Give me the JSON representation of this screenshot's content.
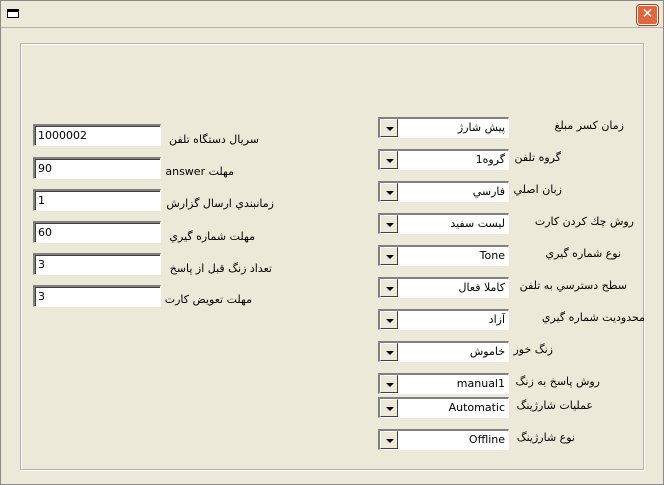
{
  "window": {
    "title": "",
    "close_glyph": "✕"
  },
  "left_fields": [
    {
      "label": "سريال دستگاه تلفن",
      "value": "1000002"
    },
    {
      "label": "مهلت answer",
      "value": "90"
    },
    {
      "label": "زمانبندي ارسال گزارش",
      "value": "1"
    },
    {
      "label": "مهلت شماره گيري",
      "value": "60"
    },
    {
      "label": "تعداد زنگ قبل از پاسخ",
      "value": "3"
    },
    {
      "label": "مهلت تعويض كارت",
      "value": "3"
    }
  ],
  "right_fields": [
    {
      "label": "زمان كسر مبلغ",
      "value": "پيش شارژ"
    },
    {
      "label": "گروه تلفن",
      "value": "گروه1"
    },
    {
      "label": "زبان اصلي",
      "value": "فارسي"
    },
    {
      "label": "روش چك كردن كارت",
      "value": "ليست سفيد"
    },
    {
      "label": "نوع شماره گيري",
      "value": "Tone"
    },
    {
      "label": "سطح دسترسي به تلفن",
      "value": "كاملا فعال"
    },
    {
      "label": "محدوديت شماره گيري",
      "value": "آزاد"
    },
    {
      "label": "زنگ خور",
      "value": "خاموش"
    },
    {
      "label": "روش پاسخ به زنگ",
      "value": "manual1"
    },
    {
      "label": "عمليات شارژينگ",
      "value": "Automatic"
    },
    {
      "label": "نوع شارژينگ",
      "value": "Offline"
    }
  ]
}
